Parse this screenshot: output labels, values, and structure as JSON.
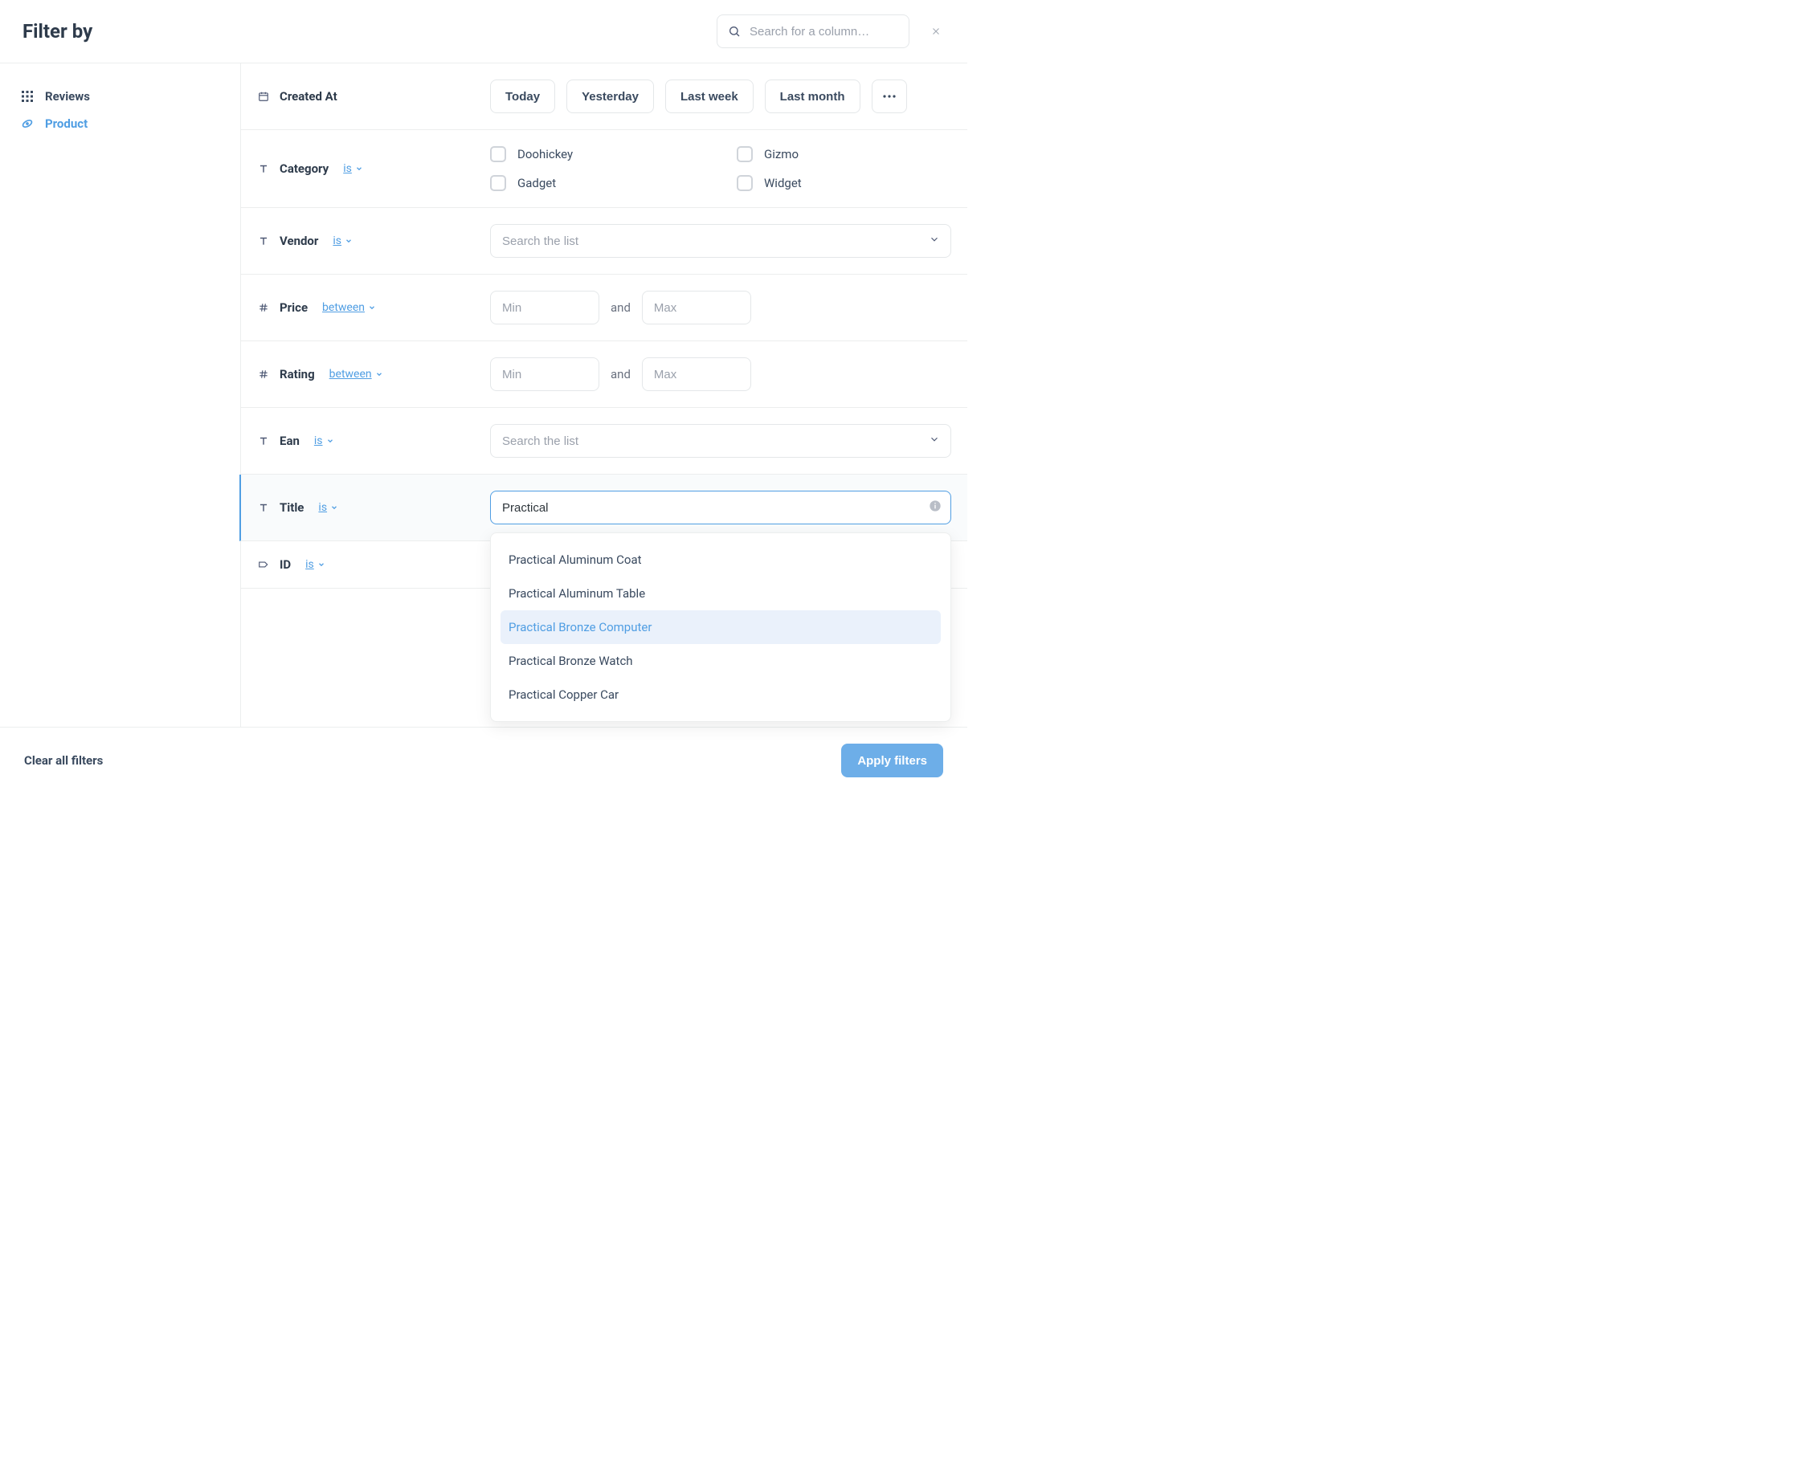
{
  "header": {
    "title": "Filter by",
    "search_placeholder": "Search for a column…"
  },
  "sidebar": {
    "items": [
      {
        "label": "Reviews",
        "icon": "grid-icon",
        "active": false
      },
      {
        "label": "Product",
        "icon": "link-icon",
        "active": true
      }
    ]
  },
  "filters": {
    "created_at": {
      "label": "Created At",
      "presets": [
        "Today",
        "Yesterday",
        "Last week",
        "Last month"
      ]
    },
    "category": {
      "label": "Category",
      "op": "is",
      "options": [
        "Doohickey",
        "Gizmo",
        "Gadget",
        "Widget"
      ]
    },
    "vendor": {
      "label": "Vendor",
      "op": "is",
      "placeholder": "Search the list"
    },
    "price": {
      "label": "Price",
      "op": "between",
      "min_placeholder": "Min",
      "max_placeholder": "Max",
      "and": "and"
    },
    "rating": {
      "label": "Rating",
      "op": "between",
      "min_placeholder": "Min",
      "max_placeholder": "Max",
      "and": "and"
    },
    "ean": {
      "label": "Ean",
      "op": "is",
      "placeholder": "Search the list"
    },
    "title": {
      "label": "Title",
      "op": "is",
      "value": "Practical",
      "suggestions": [
        "Practical Aluminum Coat",
        "Practical Aluminum Table",
        "Practical Bronze Computer",
        "Practical Bronze Watch",
        "Practical Copper Car"
      ],
      "highlight_index": 2
    },
    "id": {
      "label": "ID",
      "op": "is"
    }
  },
  "footer": {
    "clear": "Clear all filters",
    "apply": "Apply filters"
  }
}
